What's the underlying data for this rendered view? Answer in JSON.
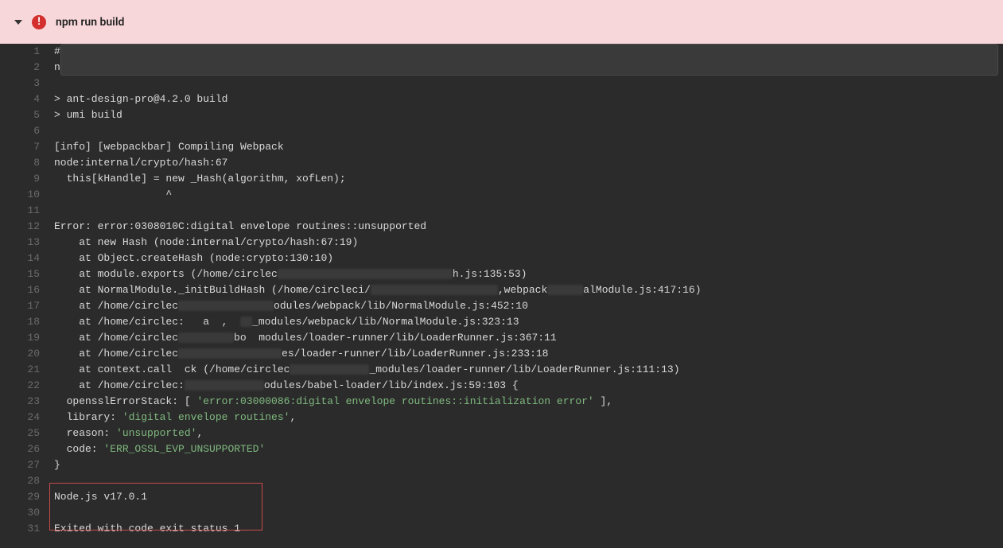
{
  "header": {
    "title": "npm run build"
  },
  "lines": [
    {
      "num": "1",
      "text": "#!/bin/bash -eo pipefail"
    },
    {
      "num": "2",
      "text": "npm run build"
    },
    {
      "num": "3",
      "text": ""
    },
    {
      "num": "4",
      "text": "> ant-design-pro@4.2.0 build"
    },
    {
      "num": "5",
      "text": "> umi build"
    },
    {
      "num": "6",
      "text": ""
    },
    {
      "num": "7",
      "text": "[info] [webpackbar] Compiling Webpack"
    },
    {
      "num": "8",
      "text": "node:internal/crypto/hash:67"
    },
    {
      "num": "9",
      "text": "  this[kHandle] = new _Hash(algorithm, xofLen);"
    },
    {
      "num": "10",
      "text": "                  ^"
    },
    {
      "num": "11",
      "text": ""
    },
    {
      "num": "12",
      "text": "Error: error:0308010C:digital envelope routines::unsupported"
    },
    {
      "num": "13",
      "text": "    at new Hash (node:internal/crypto/hash:67:19)"
    },
    {
      "num": "14",
      "text": "    at Object.createHash (node:crypto:130:10)"
    },
    {
      "num": "15",
      "segments": [
        {
          "t": "    at module.exports (/home/circlec"
        },
        {
          "smudge": 220
        },
        {
          "t": "h.js:135:53)"
        }
      ]
    },
    {
      "num": "16",
      "segments": [
        {
          "t": "    at NormalModule._initBuildHash (/home/circleci/"
        },
        {
          "smudge": 160
        },
        {
          "t": ",webpack"
        },
        {
          "smudge": 45
        },
        {
          "t": "alModule.js:417:16)"
        }
      ]
    },
    {
      "num": "17",
      "segments": [
        {
          "t": "    at /home/circlec"
        },
        {
          "smudge": 120
        },
        {
          "t": "odules/webpack/lib/NormalModule.js:452:10"
        }
      ]
    },
    {
      "num": "18",
      "segments": [
        {
          "t": "    at /home/circlec:   a  ,  "
        },
        {
          "smudge": 15
        },
        {
          "t": "_modules/webpack/lib/NormalModule.js:323:13"
        }
      ]
    },
    {
      "num": "19",
      "segments": [
        {
          "t": "    at /home/circlec"
        },
        {
          "smudge": 70
        },
        {
          "t": "bo  modules/loader-runner/lib/LoaderRunner.js:367:11"
        }
      ]
    },
    {
      "num": "20",
      "segments": [
        {
          "t": "    at /home/circlec"
        },
        {
          "smudge": 130
        },
        {
          "t": "es/loader-runner/lib/LoaderRunner.js:233:18"
        }
      ]
    },
    {
      "num": "21",
      "segments": [
        {
          "t": "    at context.call  ck (/home/circlec"
        },
        {
          "smudge": 100
        },
        {
          "t": "_modules/loader-runner/lib/LoaderRunner.js:111:13)"
        }
      ]
    },
    {
      "num": "22",
      "segments": [
        {
          "t": "    at /home/circlec:"
        },
        {
          "smudge": 100
        },
        {
          "t": "odules/babel-loader/lib/index.js:59:103 {"
        }
      ]
    },
    {
      "num": "23",
      "segments": [
        {
          "t": "  opensslErrorStack: [ "
        },
        {
          "cls": "green",
          "t": "'error:03000086:digital envelope routines::initialization error'"
        },
        {
          "t": " ],"
        }
      ]
    },
    {
      "num": "24",
      "segments": [
        {
          "t": "  library: "
        },
        {
          "cls": "green",
          "t": "'digital envelope routines'"
        },
        {
          "t": ","
        }
      ]
    },
    {
      "num": "25",
      "segments": [
        {
          "t": "  reason: "
        },
        {
          "cls": "green",
          "t": "'unsupported'"
        },
        {
          "t": ","
        }
      ]
    },
    {
      "num": "26",
      "segments": [
        {
          "t": "  code: "
        },
        {
          "cls": "green",
          "t": "'ERR_OSSL_EVP_UNSUPPORTED'"
        }
      ]
    },
    {
      "num": "27",
      "text": "}"
    },
    {
      "num": "28",
      "text": ""
    },
    {
      "num": "29",
      "text": "Node.js v17.0.1"
    },
    {
      "num": "30",
      "text": ""
    },
    {
      "num": "31",
      "text": "Exited with code exit status 1"
    }
  ]
}
